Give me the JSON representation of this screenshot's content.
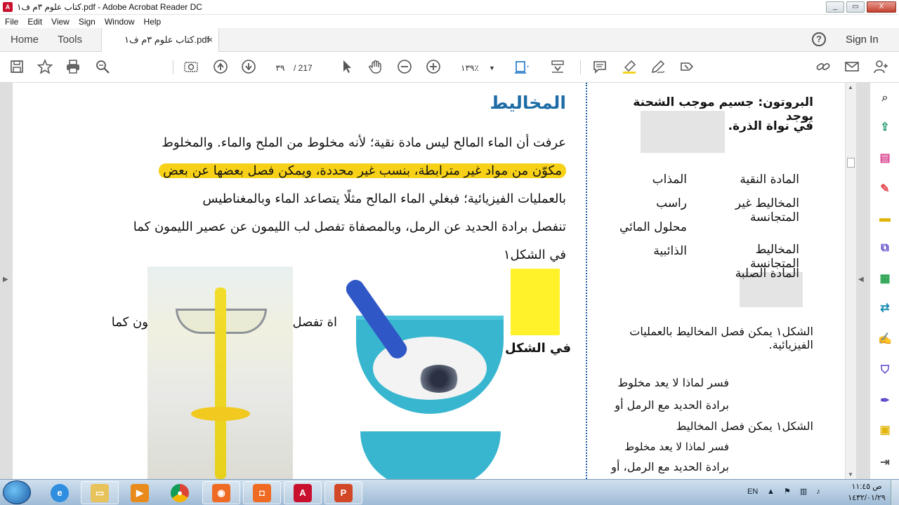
{
  "window": {
    "title": "كتاب علوم ٣م ف١.pdf - Adobe Acrobat Reader DC",
    "app_icon": "pdf-icon",
    "controls": [
      "_",
      "▭",
      "X"
    ]
  },
  "menu": [
    "File",
    "Edit",
    "View",
    "Sign",
    "Window",
    "Help"
  ],
  "tabs": {
    "home": "Home",
    "tools": "Tools",
    "doc": "كتاب علوم ٣م ف١.pdf",
    "close": "×"
  },
  "header": {
    "help": "?",
    "sign_in": "Sign In"
  },
  "toolbar": {
    "page_current": "٣٩",
    "page_total": "/ 217",
    "zoom": "١٣٩٪"
  },
  "document": {
    "heading": "المخاليط",
    "lines": [
      "عرفت أن الماء المالح ليس مادة نقية؛ لأنه مخلوط من الملح والماء. والمخلوط",
      "مكوّن من مواد غير مترابطة، بنسب غير محددة، ويمكن فصل بعضها عن بعض",
      "بالعمليات الفيزيائية؛ فبغلي الماء المالح مثلًا يتصاعد الماء وبالمغناطيس",
      "تنفصل برادة الحديد عن الرمل، وبالمصفاة تفصل لب الليمون عن عصير الليمون كما",
      "في الشكل١"
    ],
    "line_lower": "اة تفصل لب الليمون عن عصير الليمون كما",
    "fig_caption": "في الشكل١"
  },
  "sidebar_text": {
    "proton": "البروتون: جسيم موجب الشحنة يوجد",
    "proton2": "في نواة الذرة.",
    "bullets": [
      "المادة النقية",
      "المخاليط غير المتجانسة",
      "المخاليط المتجانسة",
      "المادة الصلبة"
    ],
    "bullets_left": [
      "المذاب",
      "راسب",
      "محلول المائي",
      "الذائبية"
    ],
    "fig1": "الشكل١ يمكن فصل المخاليط بالعمليات الفيزيائية.",
    "explain": "فسر لماذا لا يعد مخلوط",
    "explain2": "برادة الحديد مع الرمل أو",
    "fig1b": "الشكل١ يمكن فصل المخاليط",
    "explain3": "فسر لماذا لا يعد مخلوط",
    "explain4": "برادة الحديد مع الرمل، أو"
  },
  "taskbar": {
    "lang": "EN",
    "time": "ص ١١:٤٥",
    "date": "١٤٣٢/٠١/٢٩",
    "apps": [
      "ie-icon",
      "explorer-icon",
      "media-player-icon",
      "chrome-icon",
      "record-icon",
      "camera-icon",
      "acrobat-icon",
      "powerpoint-icon"
    ]
  },
  "colors": {
    "accent_blue": "#1e6ca6",
    "highlight": "#f7d117",
    "acrobat_red": "#c8102e"
  }
}
